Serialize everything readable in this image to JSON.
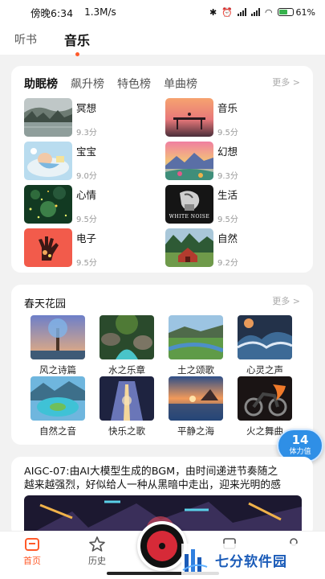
{
  "status_bar": {
    "time": "傍晚6:34",
    "speed": "1.3M/s",
    "battery": "61%"
  },
  "top_tabs": [
    {
      "label": "听书",
      "active": false
    },
    {
      "label": "音乐",
      "active": true
    }
  ],
  "rankings": {
    "tabs": [
      {
        "label": "助眠榜",
        "active": true
      },
      {
        "label": "飙升榜",
        "active": false
      },
      {
        "label": "特色榜",
        "active": false
      },
      {
        "label": "单曲榜",
        "active": false
      }
    ],
    "more_label": "更多 >",
    "items": [
      {
        "title": "冥想",
        "score": "9.3分",
        "thumb": "misty-lake"
      },
      {
        "title": "音乐",
        "score": "9.5分",
        "thumb": "sunset-pier"
      },
      {
        "title": "宝宝",
        "score": "9.0分",
        "thumb": "sleeping-baby"
      },
      {
        "title": "幻想",
        "score": "9.3分",
        "thumb": "fantasy-lake"
      },
      {
        "title": "心情",
        "score": "9.5分",
        "thumb": "night-fireflies"
      },
      {
        "title": "生活",
        "score": "9.5分",
        "thumb": "white-noise",
        "thumb_text": "WHITE NOISE"
      },
      {
        "title": "电子",
        "score": "9.5分",
        "thumb": "red-hand"
      },
      {
        "title": "自然",
        "score": "9.2分",
        "thumb": "red-barn"
      }
    ]
  },
  "garden": {
    "title": "春天花园",
    "more_label": "更多 >",
    "items": [
      {
        "label": "风之诗篇",
        "thumb": "wind-tree"
      },
      {
        "label": "水之乐章",
        "thumb": "stream-rocks"
      },
      {
        "label": "土之颂歌",
        "thumb": "river-valley"
      },
      {
        "label": "心灵之声",
        "thumb": "crashing-waves"
      },
      {
        "label": "自然之音",
        "thumb": "lagoon-island"
      },
      {
        "label": "快乐之歌",
        "thumb": "glowing-hall"
      },
      {
        "label": "平静之海",
        "thumb": "sea-sunset"
      },
      {
        "label": "火之舞曲",
        "thumb": "fire-motorbike"
      }
    ]
  },
  "stamina": {
    "value": "14",
    "label": "体力值"
  },
  "aigc": {
    "line1": "AIGC-07:由AI大模型生成的BGM，由时间递进节奏随之",
    "line2": "越来越强烈，好似给人一种从黑暗中走出，迎来光明的感"
  },
  "bottom_nav": [
    {
      "label": "首页",
      "icon": "home-icon",
      "active": true
    },
    {
      "label": "历史",
      "icon": "star-icon",
      "active": false
    }
  ],
  "watermark": "七分软件园",
  "colors": {
    "accent": "#ff5a2a",
    "stamina": "#2f8fe6",
    "watermark": "#1a5bb8"
  }
}
